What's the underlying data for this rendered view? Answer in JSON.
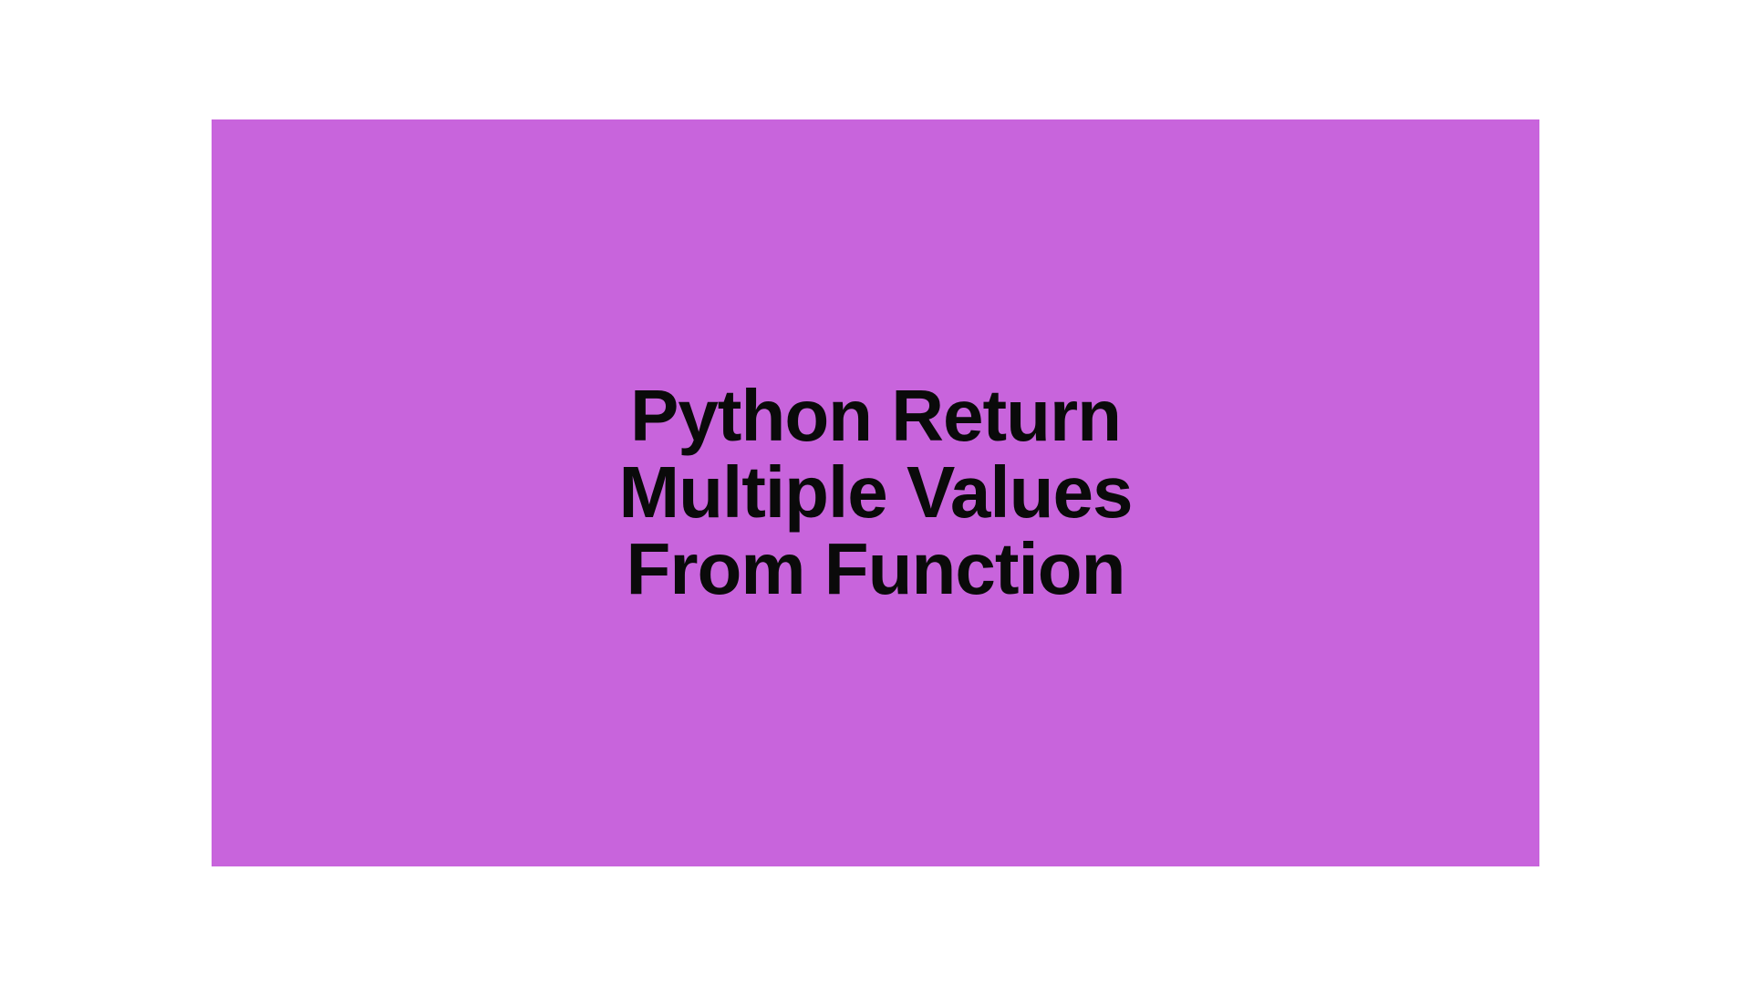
{
  "card": {
    "title_line1": "Python Return",
    "title_line2": "Multiple Values",
    "title_line3": "From Function",
    "background_color": "#c864dc",
    "text_color": "#0a0a0a"
  }
}
